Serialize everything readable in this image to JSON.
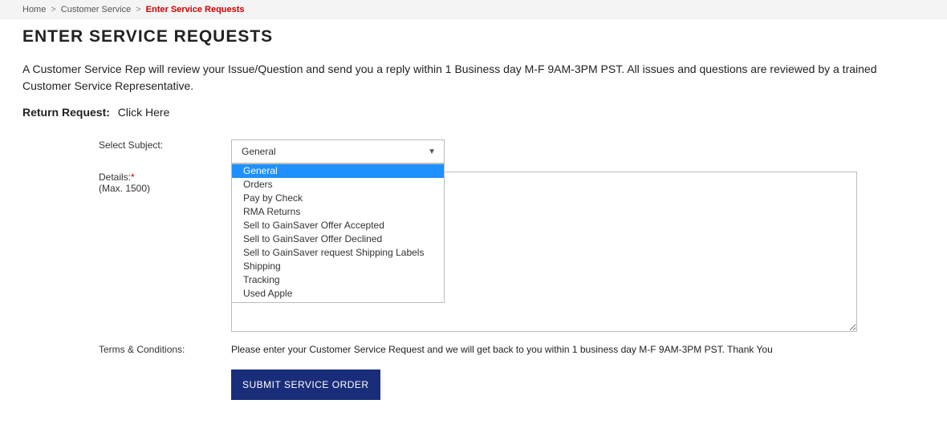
{
  "breadcrumb": {
    "home": "Home",
    "customer_service": "Customer Service",
    "current": "Enter Service Requests"
  },
  "page": {
    "title": "ENTER SERVICE REQUESTS",
    "intro": "A Customer Service Rep will review your Issue/Question and send you a reply within 1 Business day M-F 9AM-3PM PST.  All issues and questions are reviewed by a trained Customer Service Representative.",
    "return_label": "Return Request:",
    "return_link": "Click Here"
  },
  "form": {
    "subject_label": "Select Subject:",
    "subject_value": "General",
    "subject_options": [
      "General",
      "Orders",
      "Pay by Check",
      "RMA Returns",
      "Sell to GainSaver Offer Accepted",
      "Sell to GainSaver Offer Declined",
      "Sell to GainSaver request Shipping Labels",
      "Shipping",
      "Tracking",
      "Used Apple"
    ],
    "details_label": "Details:",
    "details_max": "(Max. 1500)",
    "terms_label": "Terms & Conditions:",
    "terms_text": "Please enter your Customer Service Request and we will get back to you within 1 business day M-F 9AM-3PM PST. Thank You",
    "submit_label": "SUBMIT SERVICE ORDER"
  }
}
